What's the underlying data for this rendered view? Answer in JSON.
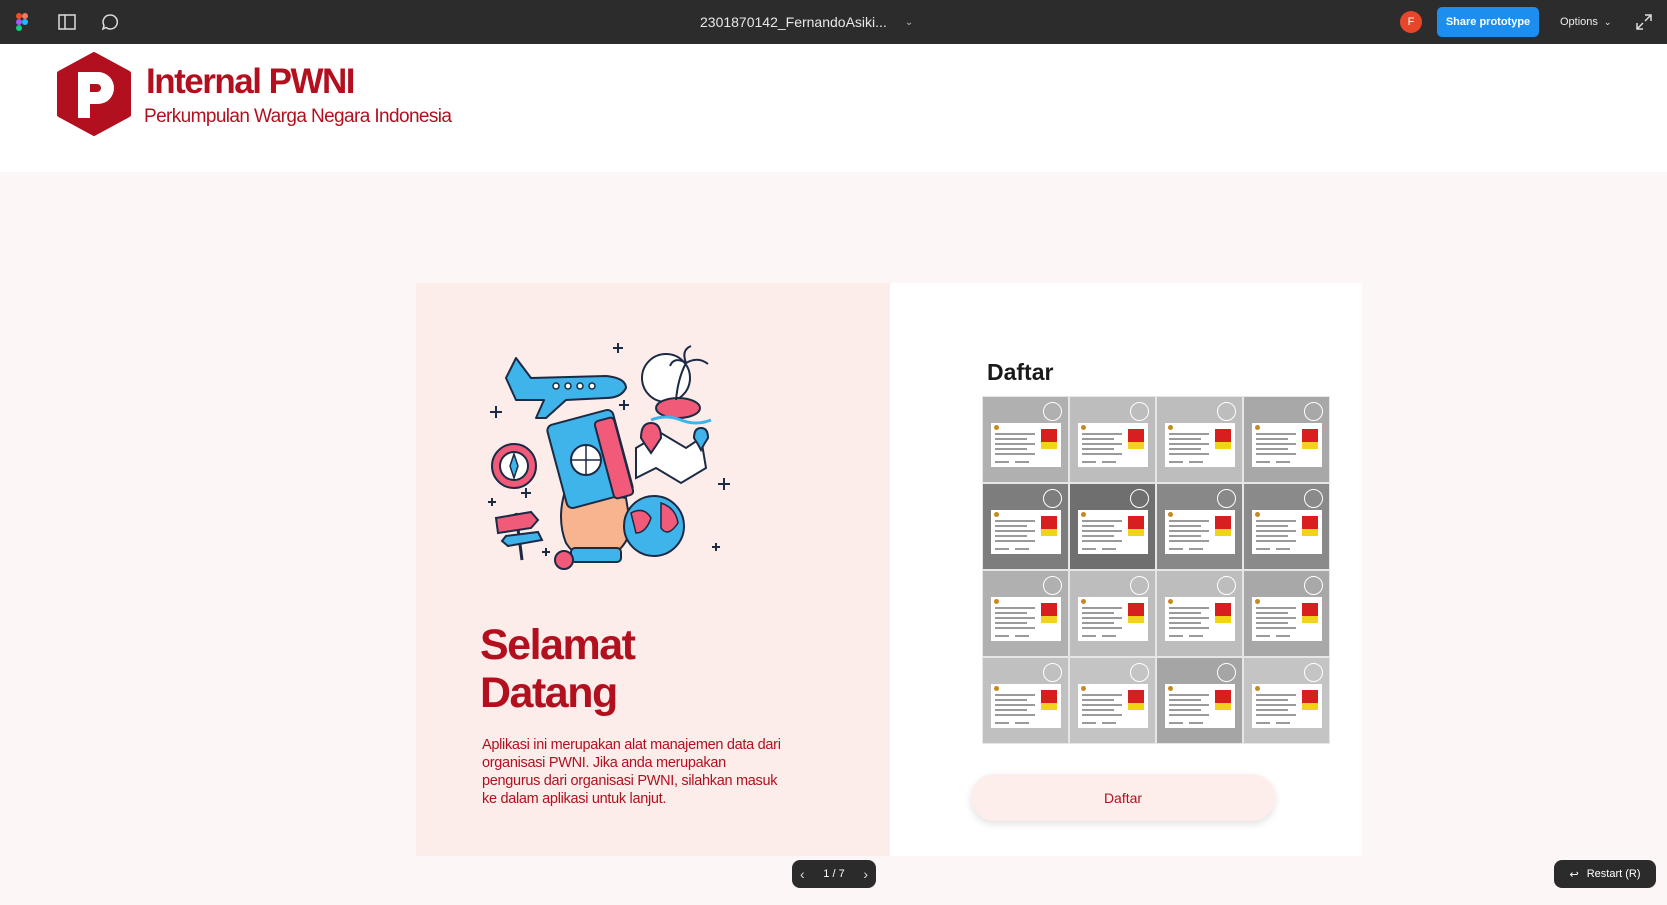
{
  "toolbar": {
    "file_title": "2301870142_FernandoAsiki...",
    "avatar_letter": "F",
    "share_label": "Share prototype",
    "options_label": "Options"
  },
  "header": {
    "brand_title": "Internal PWNI",
    "brand_subtitle": "Perkumpulan Warga Negara Indonesia"
  },
  "welcome": {
    "heading_line1": "Selamat",
    "heading_line2": "Datang",
    "description": "Aplikasi ini merupakan alat manajemen data dari organisasi PWNI. Jika anda merupakan pengurus dari organisasi PWNI, silahkan masuk ke dalam aplikasi untuk lanjut."
  },
  "register": {
    "title": "Daftar",
    "button_label": "Daftar",
    "tiles": [
      {
        "shade": "#b0b0b0"
      },
      {
        "shade": "#bdbdbd"
      },
      {
        "shade": "#bdbdbd"
      },
      {
        "shade": "#a8a8a8"
      },
      {
        "shade": "#7d7d7d"
      },
      {
        "shade": "#6f6f6f"
      },
      {
        "shade": "#888888"
      },
      {
        "shade": "#8a8a8a"
      },
      {
        "shade": "#b0b0b0"
      },
      {
        "shade": "#bdbdbd"
      },
      {
        "shade": "#bdbdbd"
      },
      {
        "shade": "#a8a8a8"
      },
      {
        "shade": "#c0c0c0"
      },
      {
        "shade": "#c4c4c4"
      },
      {
        "shade": "#a5a5a5"
      },
      {
        "shade": "#c4c4c4"
      }
    ]
  },
  "pager": {
    "label": "1 / 7"
  },
  "restart": {
    "label": "Restart (R)"
  },
  "colors": {
    "brand": "#b3101f",
    "accent": "#1b8ef0"
  }
}
